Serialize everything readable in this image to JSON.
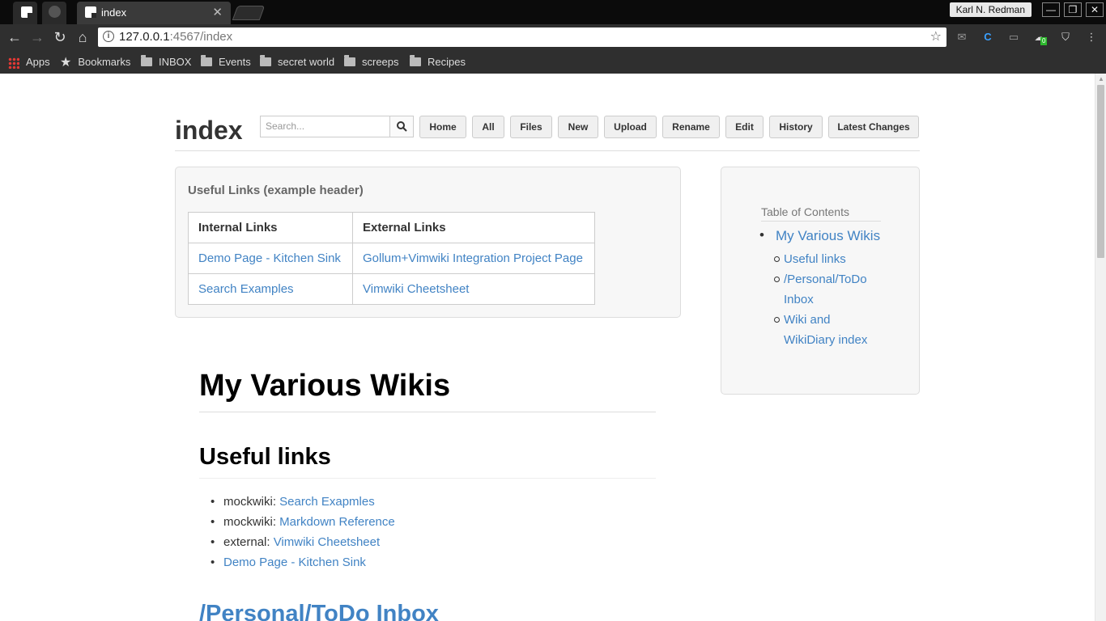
{
  "browser": {
    "active_tab_title": "index",
    "user_name": "Karl N. Redman",
    "url_host": "127.0.0.1",
    "url_rest": ":4567/index",
    "bookmarks": [
      "Apps",
      "Bookmarks",
      "INBOX",
      "Events",
      "secret world",
      "screeps",
      "Recipes"
    ],
    "extension_badge": "0"
  },
  "wiki": {
    "page_title": "index",
    "search_placeholder": "Search...",
    "nav_buttons": [
      "Home",
      "All",
      "Files",
      "New",
      "Upload",
      "Rename",
      "Edit",
      "History",
      "Latest Changes"
    ]
  },
  "header_box": {
    "title": "Useful Links (example header)",
    "columns": [
      "Internal Links",
      "External Links"
    ],
    "rows": [
      [
        "Demo Page - Kitchen Sink",
        "Gollum+Vimwiki Integration Project Page"
      ],
      [
        "Search Examples",
        "Vimwiki Cheetsheet"
      ]
    ]
  },
  "toc": {
    "label": "Table of Contents",
    "top": "My Various Wikis",
    "items": [
      "Useful links",
      "/Personal/ToDo Inbox",
      "Wiki and WikiDiary index"
    ]
  },
  "content": {
    "h1": "My Various Wikis",
    "h2": "Useful links",
    "list": [
      {
        "prefix": "mockwiki: ",
        "link": "Search Exapmles"
      },
      {
        "prefix": "mockwiki: ",
        "link": "Markdown Reference"
      },
      {
        "prefix": "external: ",
        "link": "Vimwiki Cheetsheet"
      },
      {
        "prefix": "",
        "link": "Demo Page - Kitchen Sink"
      }
    ],
    "next_heading": "/Personal/ToDo Inbox"
  }
}
